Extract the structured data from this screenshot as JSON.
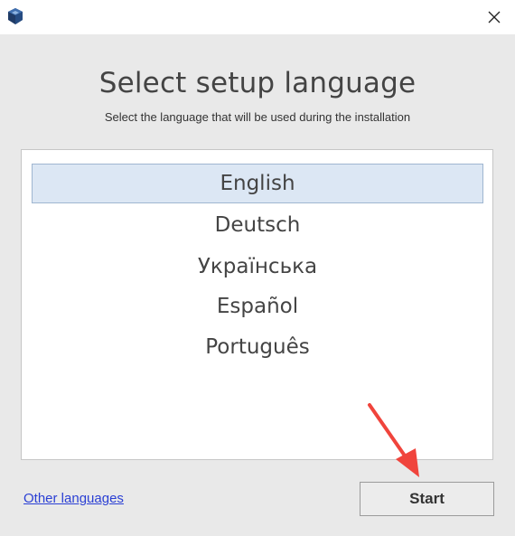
{
  "window": {
    "close_icon": "close-icon",
    "app_icon": "app-cube-icon"
  },
  "header": {
    "title": "Select setup language",
    "subtitle": "Select the language that will be used during the installation"
  },
  "languages": {
    "selected_index": 0,
    "items": [
      {
        "label": "English"
      },
      {
        "label": "Deutsch"
      },
      {
        "label": "Українська"
      },
      {
        "label": "Español"
      },
      {
        "label": "Português"
      }
    ]
  },
  "footer": {
    "other_languages_label": "Other languages",
    "start_label": "Start"
  },
  "annotation": {
    "arrow_color": "#f0443c"
  }
}
